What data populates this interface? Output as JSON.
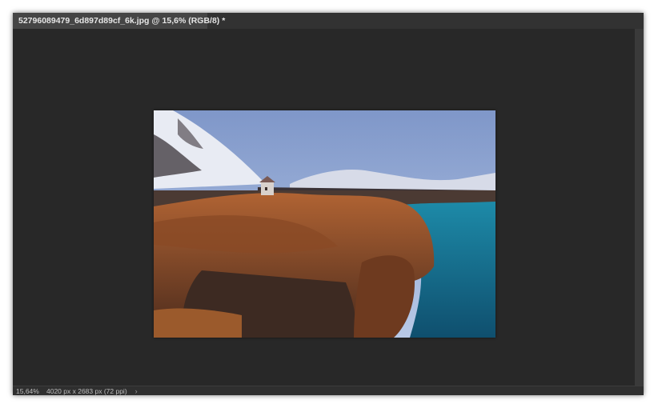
{
  "document": {
    "tab_title": "52796089479_6d897d89cf_6k.jpg @ 15,6% (RGB/8) *",
    "close_glyph": "×"
  },
  "status": {
    "zoom": "15,64%",
    "doc_info": "4020 px x 2683 px (72 ppi)",
    "arrow_glyph": "›"
  },
  "colors": {
    "workspace": "#282828",
    "tab_active": "#454545",
    "tab_bar": "#323232"
  },
  "icons": {
    "tab_close": "close-icon",
    "status_menu": "chevron-right-icon"
  }
}
